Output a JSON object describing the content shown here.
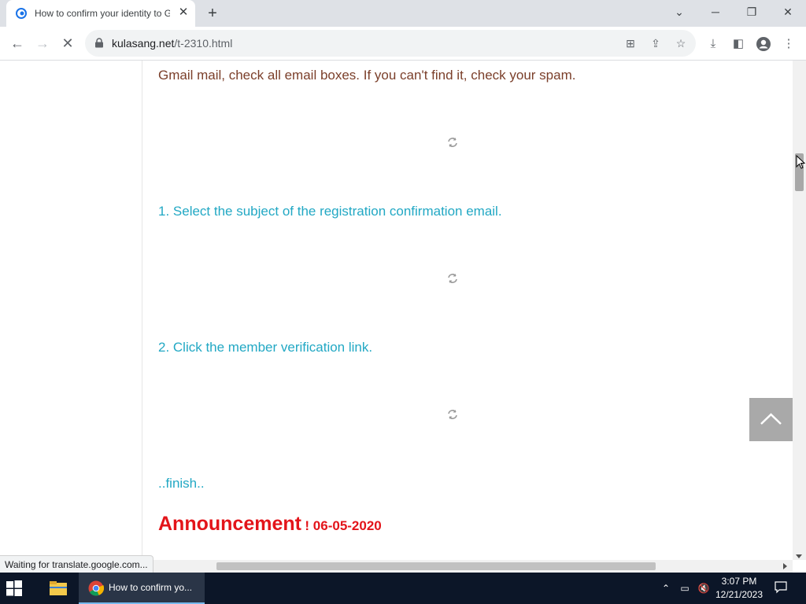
{
  "browser": {
    "tab_title": "How to confirm your identity to Gmail",
    "new_tab": "+",
    "url_host": "kulasang.net",
    "url_path": "/t-2310.html",
    "status_text": "Waiting for translate.google.com..."
  },
  "content": {
    "line_gmail": "Gmail mail, check all email boxes. If you can't find it, check your spam.",
    "step1": "1. Select the subject of the registration confirmation email.",
    "step2": "2. Click the member verification link.",
    "finish": "..finish..",
    "announcement_title": "Announcement",
    "announcement_date": "! 06-05-2020"
  },
  "taskbar": {
    "chrome_label": "How to confirm yo...",
    "time": "3:07 PM",
    "date": "12/21/2023"
  },
  "colors": {
    "brown_text": "#7b3f2a",
    "teal_text": "#22a8c4",
    "announcement_red": "#e3141a",
    "taskbar_bg": "#0c1628"
  }
}
